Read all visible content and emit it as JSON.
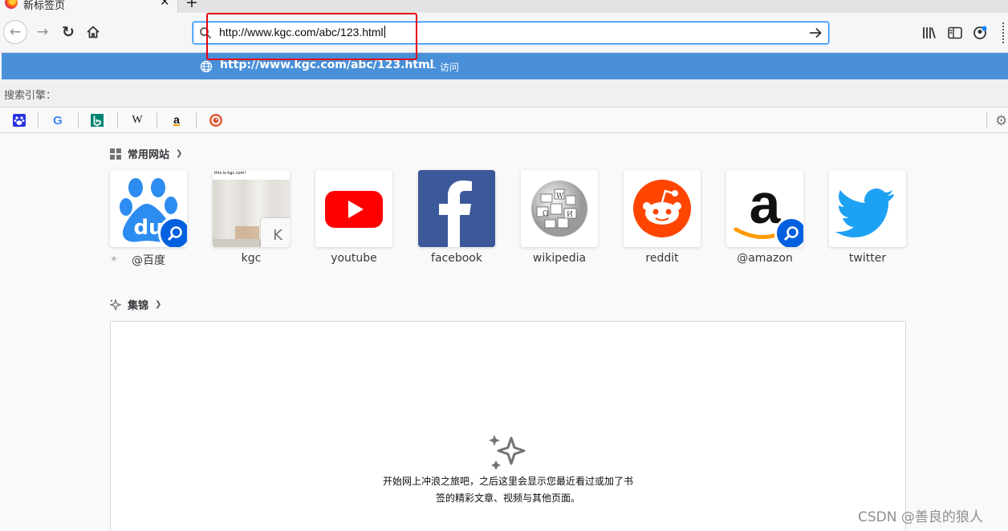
{
  "tab": {
    "title": "新标签页",
    "close": "✕",
    "new_tab": "+"
  },
  "urlbar": {
    "value": "http://www.kgc.com/abc/123.html"
  },
  "suggestion": {
    "url": "http://www.kgc.com/abc/123.html",
    "action": "— 访问"
  },
  "search_engines": {
    "label": "搜索引擎：",
    "engines": [
      "baidu-icon",
      "google-icon",
      "bing-icon",
      "wikipedia-icon",
      "amazon-icon",
      "duckduckgo-icon"
    ]
  },
  "top_sites": {
    "heading": "常用网站",
    "sites": [
      {
        "label": "@百度",
        "icon": "baidu-icon",
        "search_badge": true
      },
      {
        "label": "kgc",
        "icon": "kgc-thumbnail",
        "preview_text": "this is kgc.com!",
        "letter": "K"
      },
      {
        "label": "youtube",
        "icon": "youtube-icon"
      },
      {
        "label": "facebook",
        "icon": "facebook-icon"
      },
      {
        "label": "wikipedia",
        "icon": "wikipedia-icon"
      },
      {
        "label": "reddit",
        "icon": "reddit-icon"
      },
      {
        "label": "@amazon",
        "icon": "amazon-icon",
        "search_badge": true
      },
      {
        "label": "twitter",
        "icon": "twitter-icon"
      }
    ]
  },
  "highlights": {
    "heading": "集锦",
    "empty_line1": "开始网上冲浪之旅吧，之后这里会显示您最近看过或加了书",
    "empty_line2": "签的精彩文章、视频与其他页面。"
  },
  "watermark": "CSDN @善良的狼人",
  "colors": {
    "accent": "#0a84ff",
    "suggest_bg": "#4a90d9",
    "highlight_border": "#e60012"
  }
}
